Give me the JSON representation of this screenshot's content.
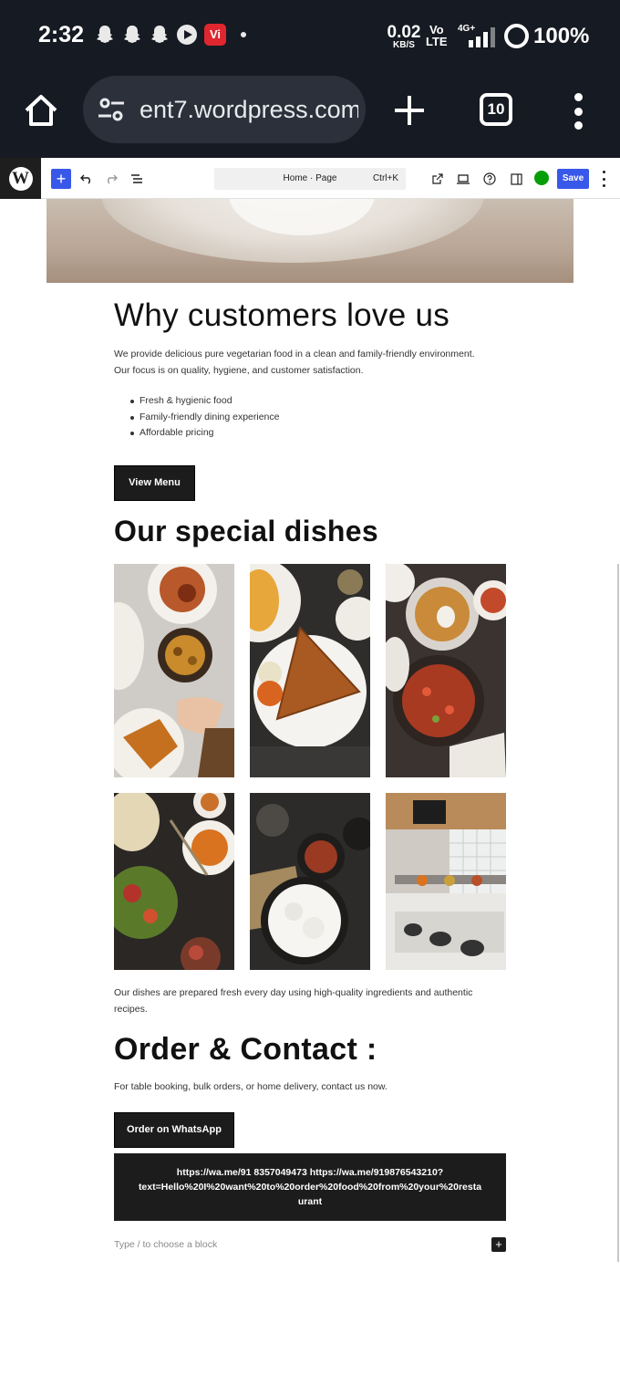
{
  "status_bar": {
    "time": "2:32",
    "net_speed": "0.02",
    "net_unit": "KB/S",
    "volte_top": "Vo",
    "volte_bottom": "LTE",
    "network_type": "4G+",
    "battery": "100%",
    "app_badge": "Vi"
  },
  "browser": {
    "url": "ent7.wordpress.com",
    "tab_count": "10"
  },
  "editor": {
    "document_title": "Home · Page",
    "shortcut": "Ctrl+K",
    "save_label": "Save",
    "inserter_label": "+",
    "wp_logo_letter": "W"
  },
  "content": {
    "why_heading": "Why customers love us",
    "why_paragraph_line1": "We provide delicious pure vegetarian food in a clean and family-friendly environment.",
    "why_paragraph_line2": "Our focus is on quality, hygiene, and customer satisfaction.",
    "features": [
      "Fresh & hygienic food",
      "Family-friendly dining experience",
      "Affordable pricing"
    ],
    "view_menu_label": "View Menu",
    "dishes_heading": "Our special dishes",
    "dishes_paragraph_line1": "Our dishes are prepared fresh every day using high-quality ingredients and authentic",
    "dishes_paragraph_line2": "recipes.",
    "order_heading": "Order & Contact :",
    "order_paragraph": "For table booking, bulk orders, or home delivery, contact us now.",
    "whatsapp_button_label": "Order on WhatsApp",
    "whatsapp_links_line1": "https://wa.me/91 8357049473 https://wa.me/919876543210?",
    "whatsapp_links_line2": "text=Hello%20I%20want%20to%20order%20food%20from%20your%20resta",
    "whatsapp_links_line3": "urant",
    "block_placeholder": "Type / to choose a block",
    "block_add_label": "+"
  },
  "colors": {
    "accent": "#3858e9",
    "dark_button": "#1c1c1c",
    "status_bar": "#161a22",
    "jetpack": "#069e08"
  }
}
